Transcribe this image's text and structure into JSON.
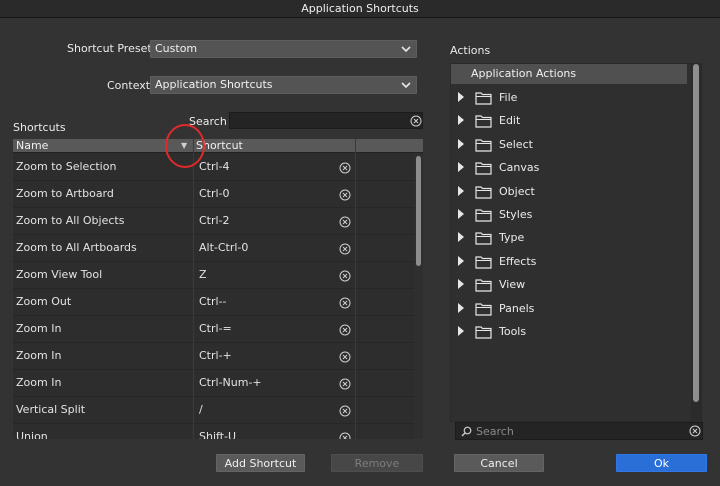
{
  "window": {
    "title": "Application Shortcuts"
  },
  "form": {
    "presets_label": "Shortcut Presets",
    "presets_value": "Custom",
    "context_label": "Context",
    "context_value": "Application Shortcuts"
  },
  "shortcuts": {
    "label": "Shortcuts",
    "search_label": "Search",
    "search_value": "",
    "columns": {
      "name": "Name",
      "shortcut": "Shortcut"
    },
    "rows": [
      {
        "name": "Zoom to Selection",
        "key": "Ctrl-4"
      },
      {
        "name": "Zoom to Artboard",
        "key": "Ctrl-0"
      },
      {
        "name": "Zoom to All Objects",
        "key": "Ctrl-2"
      },
      {
        "name": "Zoom to All Artboards",
        "key": "Alt-Ctrl-0"
      },
      {
        "name": "Zoom View Tool",
        "key": "Z"
      },
      {
        "name": "Zoom Out",
        "key": "Ctrl--"
      },
      {
        "name": "Zoom In",
        "key": "Ctrl-="
      },
      {
        "name": "Zoom In",
        "key": "Ctrl-+"
      },
      {
        "name": "Zoom In",
        "key": "Ctrl-Num-+"
      },
      {
        "name": "Vertical Split",
        "key": "/"
      },
      {
        "name": "Union",
        "key": "Shift-U"
      }
    ]
  },
  "actions": {
    "label": "Actions",
    "root": "Application Actions",
    "items": [
      "File",
      "Edit",
      "Select",
      "Canvas",
      "Object",
      "Styles",
      "Type",
      "Effects",
      "View",
      "Panels",
      "Tools"
    ],
    "search_placeholder": "Search"
  },
  "buttons": {
    "add": "Add Shortcut",
    "remove": "Remove",
    "cancel": "Cancel",
    "ok": "Ok"
  },
  "colors": {
    "accent": "#2a6ed8",
    "annotation": "#e0292a"
  },
  "icons": [
    "chevron-down-icon",
    "clear-icon",
    "sort-arrow-icon",
    "folder-icon",
    "expand-arrow-icon",
    "search-icon"
  ]
}
